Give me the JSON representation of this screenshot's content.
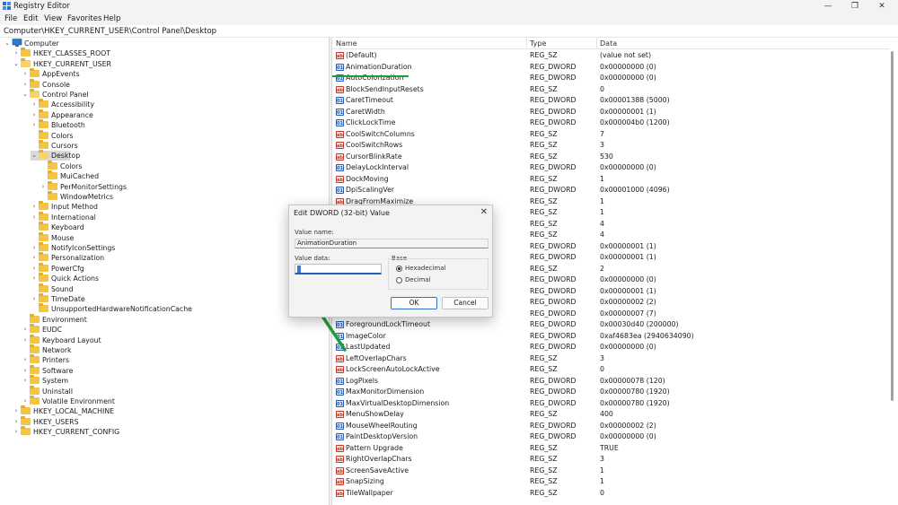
{
  "window": {
    "title": "Registry Editor",
    "controls": [
      "—",
      "❐",
      "✕"
    ]
  },
  "menu": [
    "File",
    "Edit",
    "View",
    "Favorites",
    "Help"
  ],
  "address": "Computer\\HKEY_CURRENT_USER\\Control Panel\\Desktop",
  "tree": [
    {
      "label": "Computer",
      "level": 0,
      "expander": "open",
      "icon": "computer-icon",
      "highlight": true
    },
    {
      "label": "HKEY_CLASSES_ROOT",
      "level": 1,
      "expander": "closed"
    },
    {
      "label": "HKEY_CURRENT_USER",
      "level": 1,
      "expander": "open"
    },
    {
      "label": "AppEvents",
      "level": 2,
      "expander": "closed"
    },
    {
      "label": "Console",
      "level": 2,
      "expander": "closed"
    },
    {
      "label": "Control Panel",
      "level": 2,
      "expander": "open"
    },
    {
      "label": "Accessibility",
      "level": 3,
      "expander": "closed"
    },
    {
      "label": "Appearance",
      "level": 3,
      "expander": "closed"
    },
    {
      "label": "Bluetooth",
      "level": 3,
      "expander": "closed"
    },
    {
      "label": "Colors",
      "level": 3,
      "expander": "none"
    },
    {
      "label": "Cursors",
      "level": 3,
      "expander": "none"
    },
    {
      "label": "Desktop",
      "level": 3,
      "expander": "open",
      "selected": true
    },
    {
      "label": "Colors",
      "level": 4,
      "expander": "none"
    },
    {
      "label": "MuiCached",
      "level": 4,
      "expander": "none"
    },
    {
      "label": "PerMonitorSettings",
      "level": 4,
      "expander": "closed"
    },
    {
      "label": "WindowMetrics",
      "level": 4,
      "expander": "none"
    },
    {
      "label": "Input Method",
      "level": 3,
      "expander": "closed"
    },
    {
      "label": "International",
      "level": 3,
      "expander": "closed"
    },
    {
      "label": "Keyboard",
      "level": 3,
      "expander": "none"
    },
    {
      "label": "Mouse",
      "level": 3,
      "expander": "none"
    },
    {
      "label": "NotifyIconSettings",
      "level": 3,
      "expander": "closed"
    },
    {
      "label": "Personalization",
      "level": 3,
      "expander": "closed"
    },
    {
      "label": "PowerCfg",
      "level": 3,
      "expander": "closed"
    },
    {
      "label": "Quick Actions",
      "level": 3,
      "expander": "closed"
    },
    {
      "label": "Sound",
      "level": 3,
      "expander": "none"
    },
    {
      "label": "TimeDate",
      "level": 3,
      "expander": "closed"
    },
    {
      "label": "UnsupportedHardwareNotificationCache",
      "level": 3,
      "expander": "none"
    },
    {
      "label": "Environment",
      "level": 2,
      "expander": "none"
    },
    {
      "label": "EUDC",
      "level": 2,
      "expander": "closed"
    },
    {
      "label": "Keyboard Layout",
      "level": 2,
      "expander": "closed"
    },
    {
      "label": "Network",
      "level": 2,
      "expander": "none"
    },
    {
      "label": "Printers",
      "level": 2,
      "expander": "closed"
    },
    {
      "label": "Software",
      "level": 2,
      "expander": "closed"
    },
    {
      "label": "System",
      "level": 2,
      "expander": "closed"
    },
    {
      "label": "Uninstall",
      "level": 2,
      "expander": "none"
    },
    {
      "label": "Volatile Environment",
      "level": 2,
      "expander": "closed"
    },
    {
      "label": "HKEY_LOCAL_MACHINE",
      "level": 1,
      "expander": "closed"
    },
    {
      "label": "HKEY_USERS",
      "level": 1,
      "expander": "closed"
    },
    {
      "label": "HKEY_CURRENT_CONFIG",
      "level": 1,
      "expander": "closed"
    }
  ],
  "list": {
    "headers": {
      "name": "Name",
      "type": "Type",
      "data": "Data"
    },
    "rows": [
      {
        "name": "(Default)",
        "type": "REG_SZ",
        "data": "(value not set)",
        "icon": "string-value-icon"
      },
      {
        "name": "AnimationDuration",
        "type": "REG_DWORD",
        "data": "0x00000000 (0)",
        "icon": "binary-value-icon"
      },
      {
        "name": "AutoColorization",
        "type": "REG_DWORD",
        "data": "0x00000000 (0)",
        "icon": "binary-value-icon"
      },
      {
        "name": "BlockSendInputResets",
        "type": "REG_SZ",
        "data": "0",
        "icon": "string-value-icon"
      },
      {
        "name": "CaretTimeout",
        "type": "REG_DWORD",
        "data": "0x00001388 (5000)",
        "icon": "binary-value-icon"
      },
      {
        "name": "CaretWidth",
        "type": "REG_DWORD",
        "data": "0x00000001 (1)",
        "icon": "binary-value-icon"
      },
      {
        "name": "ClickLockTime",
        "type": "REG_DWORD",
        "data": "0x000004b0 (1200)",
        "icon": "binary-value-icon"
      },
      {
        "name": "CoolSwitchColumns",
        "type": "REG_SZ",
        "data": "7",
        "icon": "string-value-icon"
      },
      {
        "name": "CoolSwitchRows",
        "type": "REG_SZ",
        "data": "3",
        "icon": "string-value-icon"
      },
      {
        "name": "CursorBlinkRate",
        "type": "REG_SZ",
        "data": "530",
        "icon": "string-value-icon"
      },
      {
        "name": "DelayLockInterval",
        "type": "REG_DWORD",
        "data": "0x00000000 (0)",
        "icon": "binary-value-icon"
      },
      {
        "name": "DockMoving",
        "type": "REG_SZ",
        "data": "1",
        "icon": "string-value-icon"
      },
      {
        "name": "DpiScalingVer",
        "type": "REG_DWORD",
        "data": "0x00001000 (4096)",
        "icon": "binary-value-icon"
      },
      {
        "name": "DragFromMaximize",
        "type": "REG_SZ",
        "data": "1",
        "icon": "string-value-icon"
      },
      {
        "name": "",
        "type": "REG_SZ",
        "data": "1",
        "icon": "string-value-icon"
      },
      {
        "name": "",
        "type": "REG_SZ",
        "data": "4",
        "icon": "string-value-icon"
      },
      {
        "name": "",
        "type": "REG_SZ",
        "data": "4",
        "icon": "string-value-icon"
      },
      {
        "name": "",
        "type": "REG_DWORD",
        "data": "0x00000001 (1)",
        "icon": "binary-value-icon"
      },
      {
        "name": "",
        "type": "REG_DWORD",
        "data": "0x00000001 (1)",
        "icon": "binary-value-icon"
      },
      {
        "name": "",
        "type": "REG_SZ",
        "data": "2",
        "icon": "string-value-icon"
      },
      {
        "name": "",
        "type": "REG_DWORD",
        "data": "0x00000000 (0)",
        "icon": "binary-value-icon"
      },
      {
        "name": "",
        "type": "REG_DWORD",
        "data": "0x00000001 (1)",
        "icon": "binary-value-icon"
      },
      {
        "name": "",
        "type": "REG_DWORD",
        "data": "0x00000002 (2)",
        "icon": "binary-value-icon"
      },
      {
        "name": "",
        "type": "REG_DWORD",
        "data": "0x00000007 (7)",
        "icon": "binary-value-icon"
      },
      {
        "name": "ForegroundLockTimeout",
        "type": "REG_DWORD",
        "data": "0x00030d40 (200000)",
        "icon": "binary-value-icon"
      },
      {
        "name": "ImageColor",
        "type": "REG_DWORD",
        "data": "0xaf4683ea (2940634090)",
        "icon": "binary-value-icon"
      },
      {
        "name": "LastUpdated",
        "type": "REG_DWORD",
        "data": "0x00000000 (0)",
        "icon": "binary-value-icon"
      },
      {
        "name": "LeftOverlapChars",
        "type": "REG_SZ",
        "data": "3",
        "icon": "string-value-icon"
      },
      {
        "name": "LockScreenAutoLockActive",
        "type": "REG_SZ",
        "data": "0",
        "icon": "string-value-icon"
      },
      {
        "name": "LogPixels",
        "type": "REG_DWORD",
        "data": "0x00000078 (120)",
        "icon": "binary-value-icon"
      },
      {
        "name": "MaxMonitorDimension",
        "type": "REG_DWORD",
        "data": "0x00000780 (1920)",
        "icon": "binary-value-icon"
      },
      {
        "name": "MaxVirtualDesktopDimension",
        "type": "REG_DWORD",
        "data": "0x00000780 (1920)",
        "icon": "binary-value-icon"
      },
      {
        "name": "MenuShowDelay",
        "type": "REG_SZ",
        "data": "400",
        "icon": "string-value-icon"
      },
      {
        "name": "MouseWheelRouting",
        "type": "REG_DWORD",
        "data": "0x00000002 (2)",
        "icon": "binary-value-icon"
      },
      {
        "name": "PaintDesktopVersion",
        "type": "REG_DWORD",
        "data": "0x00000000 (0)",
        "icon": "binary-value-icon"
      },
      {
        "name": "Pattern Upgrade",
        "type": "REG_SZ",
        "data": "TRUE",
        "icon": "string-value-icon"
      },
      {
        "name": "RightOverlapChars",
        "type": "REG_SZ",
        "data": "3",
        "icon": "string-value-icon"
      },
      {
        "name": "ScreenSaveActive",
        "type": "REG_SZ",
        "data": "1",
        "icon": "string-value-icon"
      },
      {
        "name": "SnapSizing",
        "type": "REG_SZ",
        "data": "1",
        "icon": "string-value-icon"
      },
      {
        "name": "TileWallpaper",
        "type": "REG_SZ",
        "data": "0",
        "icon": "string-value-icon"
      }
    ]
  },
  "dialog": {
    "title": "Edit DWORD (32-bit) Value",
    "value_name_label": "Value name:",
    "value_name": "AnimationDuration",
    "value_data_label": "Value data:",
    "value_data": "0",
    "base_label": "Base",
    "base_options": [
      {
        "label": "Hexadecimal",
        "checked": true
      },
      {
        "label": "Decimal",
        "checked": false
      }
    ],
    "ok_label": "OK",
    "cancel_label": "Cancel",
    "close_glyph": "✕"
  },
  "colors": {
    "annotation_green": "#1f9d3a",
    "computer_highlight": "#8fd6a0",
    "accent_blue": "#1f5fbf"
  }
}
